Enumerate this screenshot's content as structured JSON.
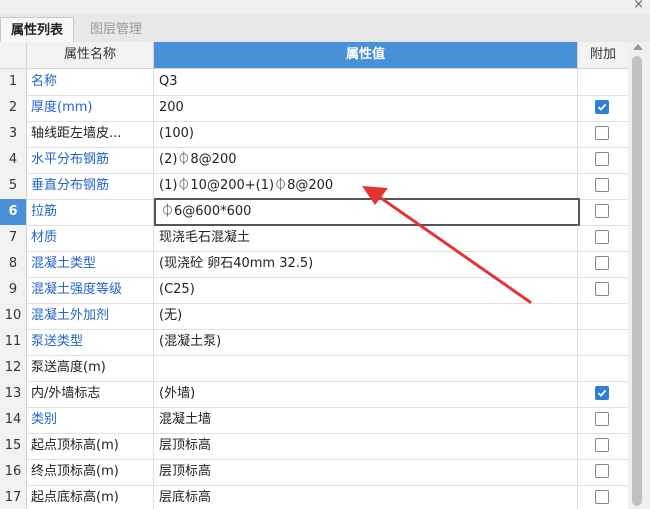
{
  "close_glyph": "×",
  "tabs": [
    {
      "label": "属性列表",
      "active": true
    },
    {
      "label": "图层管理",
      "active": false
    }
  ],
  "header": {
    "name": "属性名称",
    "value": "属性值",
    "add": "附加"
  },
  "colors": {
    "accent": "#4a90d9",
    "link": "#2266cc",
    "annotation_arrow": "#e53333"
  },
  "rows": [
    {
      "no": "1",
      "name": "名称",
      "value": "Q3",
      "checkbox": null
    },
    {
      "no": "2",
      "name": "厚度(mm)",
      "value": "200",
      "checkbox": true
    },
    {
      "no": "3",
      "name": "轴线距左墙皮...",
      "value": "(100)",
      "checkbox": false
    },
    {
      "no": "4",
      "name": "水平分布钢筋",
      "value": "(2)⏀8@200",
      "checkbox": false
    },
    {
      "no": "5",
      "name": "垂直分布钢筋",
      "value": "(1)⏀10@200+(1)⏀8@200",
      "checkbox": false
    },
    {
      "no": "6",
      "name": "拉筋",
      "value": "⏀6@600*600",
      "checkbox": false,
      "selected": true
    },
    {
      "no": "7",
      "name": "材质",
      "value": "现浇毛石混凝土",
      "checkbox": false
    },
    {
      "no": "8",
      "name": "混凝土类型",
      "value": "(现浇砼 卵石40mm 32.5)",
      "checkbox": false
    },
    {
      "no": "9",
      "name": "混凝土强度等级",
      "value": "(C25)",
      "checkbox": false
    },
    {
      "no": "10",
      "name": "混凝土外加剂",
      "value": "(无)",
      "checkbox": null
    },
    {
      "no": "11",
      "name": "泵送类型",
      "value": "(混凝土泵)",
      "checkbox": null
    },
    {
      "no": "12",
      "name": "泵送高度(m)",
      "value": "",
      "checkbox": null
    },
    {
      "no": "13",
      "name": "内/外墙标志",
      "value": "(外墙)",
      "checkbox": true
    },
    {
      "no": "14",
      "name": "类别",
      "value": "混凝土墙",
      "checkbox": false
    },
    {
      "no": "15",
      "name": "起点顶标高(m)",
      "value": "层顶标高",
      "checkbox": false
    },
    {
      "no": "16",
      "name": "终点顶标高(m)",
      "value": "层顶标高",
      "checkbox": false
    },
    {
      "no": "17",
      "name": "起点底标高(m)",
      "value": "层底标高",
      "checkbox": false
    }
  ]
}
